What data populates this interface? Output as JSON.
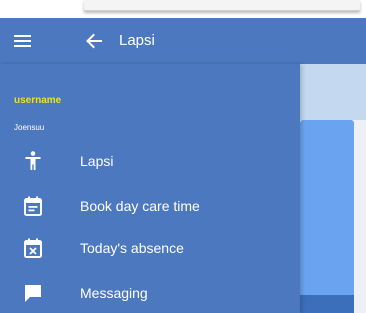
{
  "app_bar": {
    "title": "Lapsi",
    "menu_icon": "hamburger-menu-icon",
    "back_icon": "arrow-back-icon",
    "color": "#4c78c0"
  },
  "drawer": {
    "username": "username",
    "location": "Joensuu",
    "username_color": "#e6e51d",
    "background": "#4c78c0",
    "items": [
      {
        "label": "Lapsi",
        "icon": "child-icon"
      },
      {
        "label": "Book day care time",
        "icon": "calendar-icon"
      },
      {
        "label": "Today's absence",
        "icon": "calendar-cancel-icon"
      },
      {
        "label": "Messaging",
        "icon": "message-icon"
      }
    ]
  }
}
